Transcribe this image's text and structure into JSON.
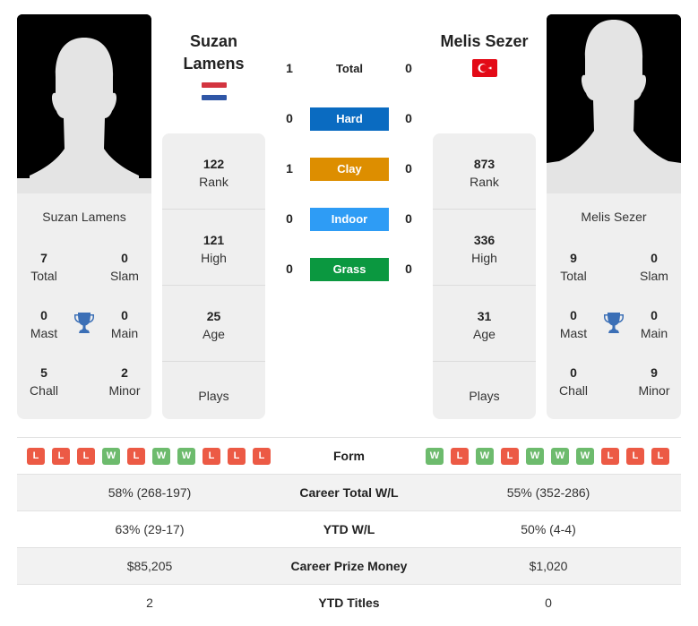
{
  "player1": {
    "name": "Suzan Lamens",
    "header_line1": "Suzan",
    "header_line2": "Lamens",
    "country": "Netherlands",
    "flag_icon": "netherlands-flag-icon",
    "titles": {
      "total": "7",
      "slam": "0",
      "mast": "0",
      "main": "0",
      "chall": "5",
      "minor": "2"
    },
    "rank": "122",
    "high": "121",
    "age": "25",
    "plays": "",
    "form": [
      "L",
      "L",
      "L",
      "W",
      "L",
      "W",
      "W",
      "L",
      "L",
      "L"
    ],
    "career_wl": "58% (268-197)",
    "ytd_wl": "63% (29-17)",
    "prize_money": "$85,205",
    "ytd_titles": "2"
  },
  "player2": {
    "name": "Melis Sezer",
    "country": "Turkey",
    "flag_icon": "turkey-flag-icon",
    "titles": {
      "total": "9",
      "slam": "0",
      "mast": "0",
      "main": "0",
      "chall": "0",
      "minor": "9"
    },
    "rank": "873",
    "high": "336",
    "age": "31",
    "plays": "",
    "form": [
      "W",
      "L",
      "W",
      "L",
      "W",
      "W",
      "W",
      "L",
      "L",
      "L"
    ],
    "career_wl": "55% (352-286)",
    "ytd_wl": "50% (4-4)",
    "prize_money": "$1,020",
    "ytd_titles": "0"
  },
  "labels": {
    "total": "Total",
    "slam": "Slam",
    "mast": "Mast",
    "main": "Main",
    "chall": "Chall",
    "minor": "Minor",
    "rank": "Rank",
    "high": "High",
    "age": "Age",
    "plays": "Plays",
    "form": "Form",
    "career_wl": "Career Total W/L",
    "ytd_wl": "YTD W/L",
    "prize_money": "Career Prize Money",
    "ytd_titles": "YTD Titles"
  },
  "h2h": [
    {
      "surface": "Total",
      "p1": "1",
      "p2": "0",
      "color": ""
    },
    {
      "surface": "Hard",
      "p1": "0",
      "p2": "0",
      "color": "#0a6bc1"
    },
    {
      "surface": "Clay",
      "p1": "1",
      "p2": "0",
      "color": "#dd8e00"
    },
    {
      "surface": "Indoor",
      "p1": "0",
      "p2": "0",
      "color": "#2e9cf5"
    },
    {
      "surface": "Grass",
      "p1": "0",
      "p2": "0",
      "color": "#0b9840"
    }
  ],
  "colors": {
    "win": "#6dbb6d",
    "loss": "#ec5a45",
    "trophy": "#3b6fb6"
  }
}
